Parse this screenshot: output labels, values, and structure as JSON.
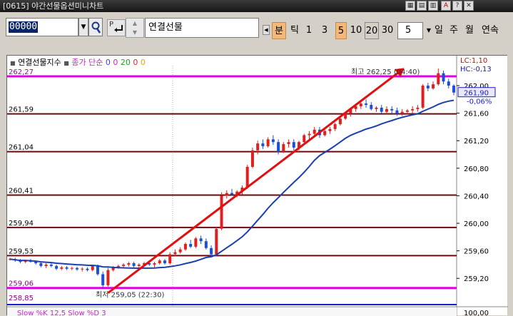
{
  "window": {
    "title": "[0615] 야간선물옵션미니차트",
    "buttons": [
      "▦",
      "▤",
      "▥",
      "A",
      "?",
      "✕"
    ]
  },
  "toolbar": {
    "code_value": "00000",
    "product_name": "연결선물",
    "p_label": "P",
    "periods": [
      "분",
      "틱",
      "1",
      "3",
      "5",
      "10",
      "20",
      "30"
    ],
    "active_period_index": 0,
    "count_value": "5",
    "units": [
      "일",
      "주",
      "월",
      "연속"
    ]
  },
  "chart": {
    "legend_title": "연결선물지수",
    "legend_ma_label": "종가 단순",
    "legend_ma_values": [
      "0",
      "0",
      "20",
      "0",
      "0"
    ],
    "legend_colors": [
      "#3c3cff",
      "#d020d0",
      "#20a020",
      "#ff2020",
      "#e0a020"
    ],
    "top_left_value": "262,27",
    "lc_label": "LC:1,10",
    "hc_label": "HC:-0,13",
    "left_levels": [
      {
        "label": "261,59",
        "value": 261.59
      },
      {
        "label": "261,04",
        "value": 261.04
      },
      {
        "label": "260,41",
        "value": 260.41
      },
      {
        "label": "259,94",
        "value": 259.94
      },
      {
        "label": "259,53",
        "value": 259.53
      },
      {
        "label": "259,06",
        "value": 259.06
      },
      {
        "label": "258,85",
        "value": 258.85
      }
    ],
    "right_ticks": [
      "262,00",
      "261,60",
      "261,20",
      "260,80",
      "260,40",
      "260,00",
      "259,60",
      "259,20"
    ],
    "current_price": "261,90",
    "current_change": "-0,06%",
    "high_annotation": "최고 262,25 (04:40)",
    "low_annotation": "최저 259,05 (22:30)",
    "bottom_right_tick": "100,00",
    "bottom_panel_label": "Slow %K 12,5  Slow %D 3",
    "colors": {
      "up": "#e02020",
      "down": "#1a4fd8",
      "ma": "#1a3fb0",
      "support_line": "#6a0a0a",
      "magenta_line": "#e000e0",
      "trend_arrow": "#e01010"
    }
  },
  "chart_data": {
    "type": "candlestick",
    "title": "연결선물지수",
    "ylim": [
      258.85,
      262.27
    ],
    "horizontal_levels": [
      261.59,
      261.04,
      260.41,
      259.94,
      259.53,
      259.06
    ],
    "high": {
      "value": 262.25,
      "time": "04:40"
    },
    "low": {
      "value": 259.05,
      "time": "22:30"
    },
    "last": 261.9,
    "candles": [
      [
        259.48,
        259.5,
        259.46,
        259.48
      ],
      [
        259.48,
        259.5,
        259.44,
        259.46
      ],
      [
        259.46,
        259.48,
        259.42,
        259.44
      ],
      [
        259.44,
        259.47,
        259.42,
        259.46
      ],
      [
        259.46,
        259.48,
        259.43,
        259.44
      ],
      [
        259.44,
        259.46,
        259.4,
        259.42
      ],
      [
        259.42,
        259.44,
        259.36,
        259.38
      ],
      [
        259.38,
        259.42,
        259.35,
        259.4
      ],
      [
        259.4,
        259.42,
        259.36,
        259.38
      ],
      [
        259.38,
        259.4,
        259.32,
        259.34
      ],
      [
        259.34,
        259.38,
        259.32,
        259.36
      ],
      [
        259.36,
        259.38,
        259.32,
        259.34
      ],
      [
        259.34,
        259.37,
        259.32,
        259.35
      ],
      [
        259.35,
        259.37,
        259.31,
        259.33
      ],
      [
        259.33,
        259.36,
        259.3,
        259.34
      ],
      [
        259.34,
        259.36,
        259.3,
        259.32
      ],
      [
        259.32,
        259.4,
        259.3,
        259.38
      ],
      [
        259.38,
        259.4,
        259.24,
        259.26
      ],
      [
        259.26,
        259.3,
        259.05,
        259.1
      ],
      [
        259.1,
        259.35,
        259.08,
        259.32
      ],
      [
        259.32,
        259.38,
        259.3,
        259.36
      ],
      [
        259.36,
        259.4,
        259.34,
        259.38
      ],
      [
        259.38,
        259.42,
        259.36,
        259.4
      ],
      [
        259.4,
        259.44,
        259.37,
        259.42
      ],
      [
        259.42,
        259.44,
        259.36,
        259.38
      ],
      [
        259.38,
        259.42,
        259.36,
        259.4
      ],
      [
        259.4,
        259.44,
        259.38,
        259.42
      ],
      [
        259.42,
        259.45,
        259.38,
        259.4
      ],
      [
        259.4,
        259.44,
        259.36,
        259.42
      ],
      [
        259.42,
        259.48,
        259.4,
        259.46
      ],
      [
        259.46,
        259.48,
        259.4,
        259.42
      ],
      [
        259.42,
        259.58,
        259.4,
        259.55
      ],
      [
        259.55,
        259.62,
        259.52,
        259.58
      ],
      [
        259.58,
        259.65,
        259.56,
        259.62
      ],
      [
        259.62,
        259.72,
        259.6,
        259.7
      ],
      [
        259.7,
        259.76,
        259.64,
        259.66
      ],
      [
        259.66,
        259.8,
        259.64,
        259.78
      ],
      [
        259.78,
        259.82,
        259.7,
        259.74
      ],
      [
        259.74,
        259.78,
        259.62,
        259.64
      ],
      [
        259.64,
        259.68,
        259.52,
        259.55
      ],
      [
        259.55,
        259.95,
        259.52,
        259.92
      ],
      [
        259.92,
        260.45,
        259.9,
        260.4
      ],
      [
        260.4,
        260.48,
        260.36,
        260.44
      ],
      [
        260.44,
        260.5,
        260.4,
        260.42
      ],
      [
        260.42,
        260.48,
        260.38,
        260.46
      ],
      [
        260.46,
        260.55,
        260.42,
        260.52
      ],
      [
        260.52,
        260.85,
        260.5,
        260.82
      ],
      [
        260.82,
        261.1,
        260.8,
        261.06
      ],
      [
        261.06,
        261.2,
        261.0,
        261.16
      ],
      [
        261.16,
        261.22,
        261.08,
        261.12
      ],
      [
        261.12,
        261.25,
        261.1,
        261.22
      ],
      [
        261.22,
        261.28,
        261.14,
        261.18
      ],
      [
        261.18,
        261.22,
        261.0,
        261.04
      ],
      [
        261.04,
        261.18,
        261.02,
        261.15
      ],
      [
        261.15,
        261.22,
        261.1,
        261.18
      ],
      [
        261.18,
        261.22,
        261.06,
        261.1
      ],
      [
        261.1,
        261.2,
        261.06,
        261.18
      ],
      [
        261.18,
        261.3,
        261.16,
        261.28
      ],
      [
        261.28,
        261.34,
        261.22,
        261.3
      ],
      [
        261.3,
        261.4,
        261.26,
        261.36
      ],
      [
        261.36,
        261.4,
        261.24,
        261.28
      ],
      [
        261.28,
        261.38,
        261.26,
        261.34
      ],
      [
        261.34,
        261.4,
        261.3,
        261.37
      ],
      [
        261.37,
        261.46,
        261.34,
        261.44
      ],
      [
        261.44,
        261.55,
        261.42,
        261.52
      ],
      [
        261.52,
        261.62,
        261.5,
        261.6
      ],
      [
        261.6,
        261.68,
        261.55,
        261.66
      ],
      [
        261.66,
        261.74,
        261.62,
        261.7
      ],
      [
        261.7,
        261.78,
        261.66,
        261.74
      ],
      [
        261.74,
        261.8,
        261.68,
        261.72
      ],
      [
        261.72,
        261.76,
        261.64,
        261.66
      ],
      [
        261.66,
        261.7,
        261.62,
        261.68
      ],
      [
        261.68,
        261.72,
        261.6,
        261.62
      ],
      [
        261.62,
        261.7,
        261.58,
        261.66
      ],
      [
        261.66,
        261.7,
        261.6,
        261.64
      ],
      [
        261.64,
        261.68,
        261.56,
        261.6
      ],
      [
        261.6,
        261.66,
        261.56,
        261.62
      ],
      [
        261.62,
        261.66,
        261.58,
        261.64
      ],
      [
        261.64,
        261.7,
        261.6,
        261.66
      ],
      [
        261.66,
        261.72,
        261.62,
        261.68
      ],
      [
        261.68,
        262.02,
        261.66,
        262.0
      ],
      [
        262.0,
        262.04,
        261.92,
        261.96
      ],
      [
        261.96,
        262.06,
        261.94,
        262.02
      ],
      [
        262.02,
        262.25,
        262.0,
        262.18
      ],
      [
        262.18,
        262.22,
        262.02,
        262.06
      ],
      [
        262.06,
        262.1,
        261.96,
        262.0
      ],
      [
        262.0,
        262.02,
        261.86,
        261.9
      ]
    ]
  }
}
